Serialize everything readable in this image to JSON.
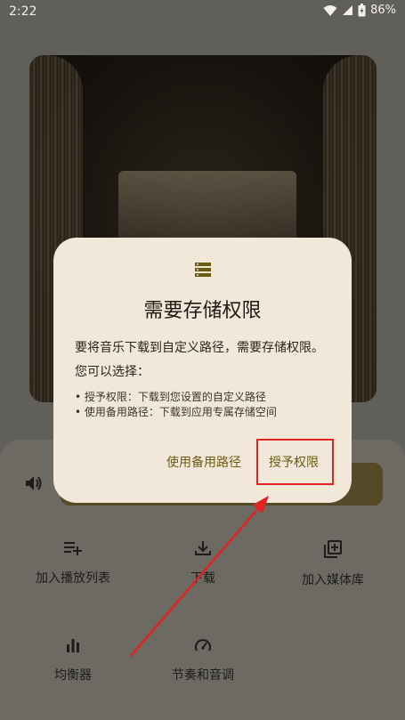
{
  "status_bar": {
    "time": "2:22",
    "battery": "86%"
  },
  "player": {
    "actions": [
      {
        "label": "加入播放列表",
        "icon": "playlist-add-icon"
      },
      {
        "label": "下载",
        "icon": "download-icon"
      },
      {
        "label": "加入媒体库",
        "icon": "library-add-icon"
      },
      {
        "label": "均衡器",
        "icon": "equalizer-icon"
      },
      {
        "label": "节奏和音调",
        "icon": "speed-icon"
      }
    ]
  },
  "dialog": {
    "icon": "storage-icon",
    "title": "需要存储权限",
    "message": "要将音乐下载到自定义路径，需要存储权限。",
    "subheading": "您可以选择：",
    "options": [
      "• 授予权限：下载到您设置的自定义路径",
      "• 使用备用路径：下载到应用专属存储空间"
    ],
    "secondary_button": "使用备用路径",
    "primary_button": "授予权限"
  },
  "colors": {
    "dialog_bg": "#f1e8d9",
    "accent_text": "#6b5a12",
    "annotation": "#e02323"
  }
}
